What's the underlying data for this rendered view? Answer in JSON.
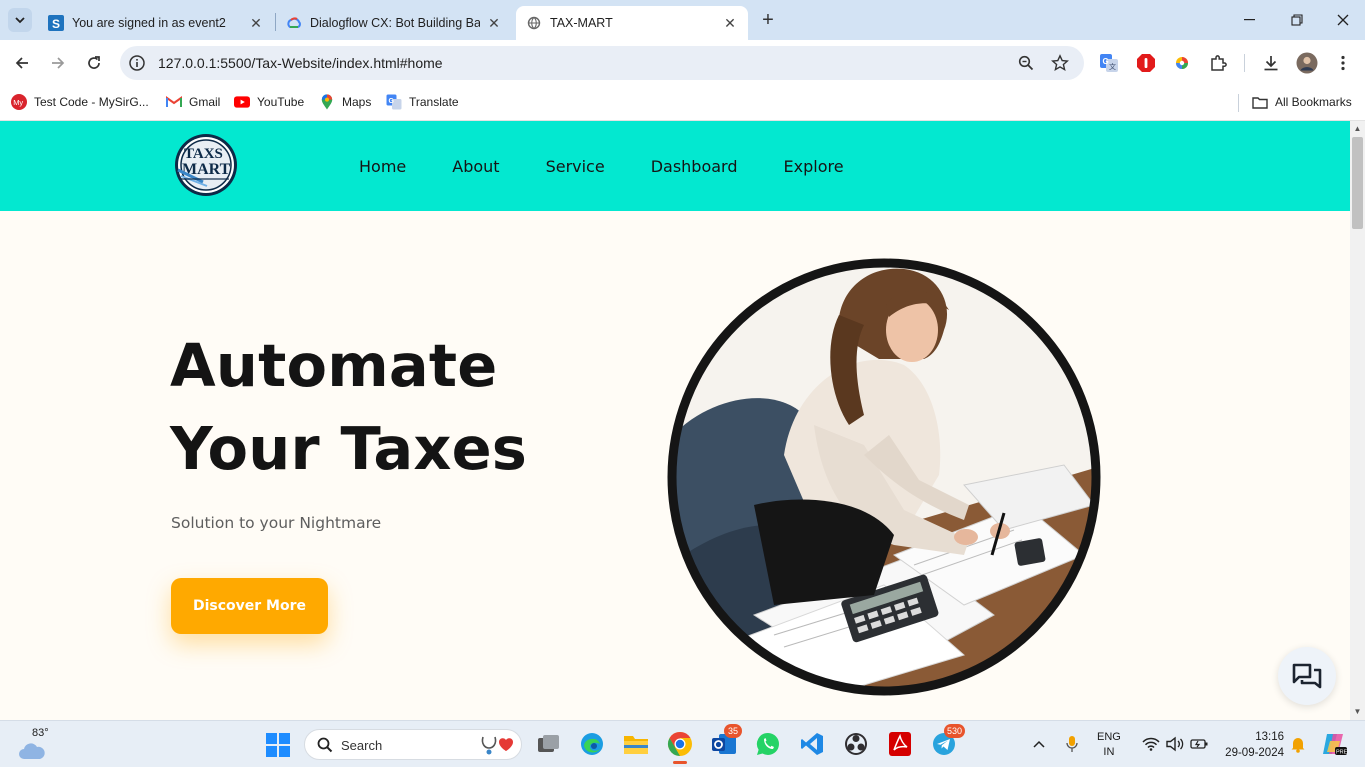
{
  "browser": {
    "tabs": [
      {
        "title": "You are signed in as event2",
        "active": false
      },
      {
        "title": "Dialogflow CX: Bot Building Bas",
        "active": false
      },
      {
        "title": "TAX-MART",
        "active": true
      }
    ],
    "url": "127.0.0.1:5500/Tax-Website/index.html#home",
    "bookmarks": [
      {
        "label": "Test Code - MySirG...",
        "icon": "mysirg-icon"
      },
      {
        "label": "Gmail",
        "icon": "gmail-icon"
      },
      {
        "label": "YouTube",
        "icon": "youtube-icon"
      },
      {
        "label": "Maps",
        "icon": "maps-icon"
      },
      {
        "label": "Translate",
        "icon": "translate-icon"
      }
    ],
    "all_bookmarks_label": "All Bookmarks"
  },
  "site": {
    "nav": [
      "Home",
      "About",
      "Service",
      "Dashboard",
      "Explore"
    ],
    "logo_text_top": "TAXS",
    "logo_text_bottom": "MART",
    "hero": {
      "title_line1": "Automate",
      "title_line2": "Your Taxes",
      "subtitle": "Solution to your Nightmare",
      "cta_label": "Discover More"
    },
    "colors": {
      "nav_bg": "#03e8d0",
      "page_bg": "#fffcf6",
      "cta_bg": "#ffa900"
    }
  },
  "taskbar": {
    "weather_temp": "83°",
    "search_label": "Search",
    "outlook_badge": "35",
    "telegram_badge": "530",
    "lang_line1": "ENG",
    "lang_line2": "IN",
    "time": "13:16",
    "date": "29-09-2024"
  }
}
